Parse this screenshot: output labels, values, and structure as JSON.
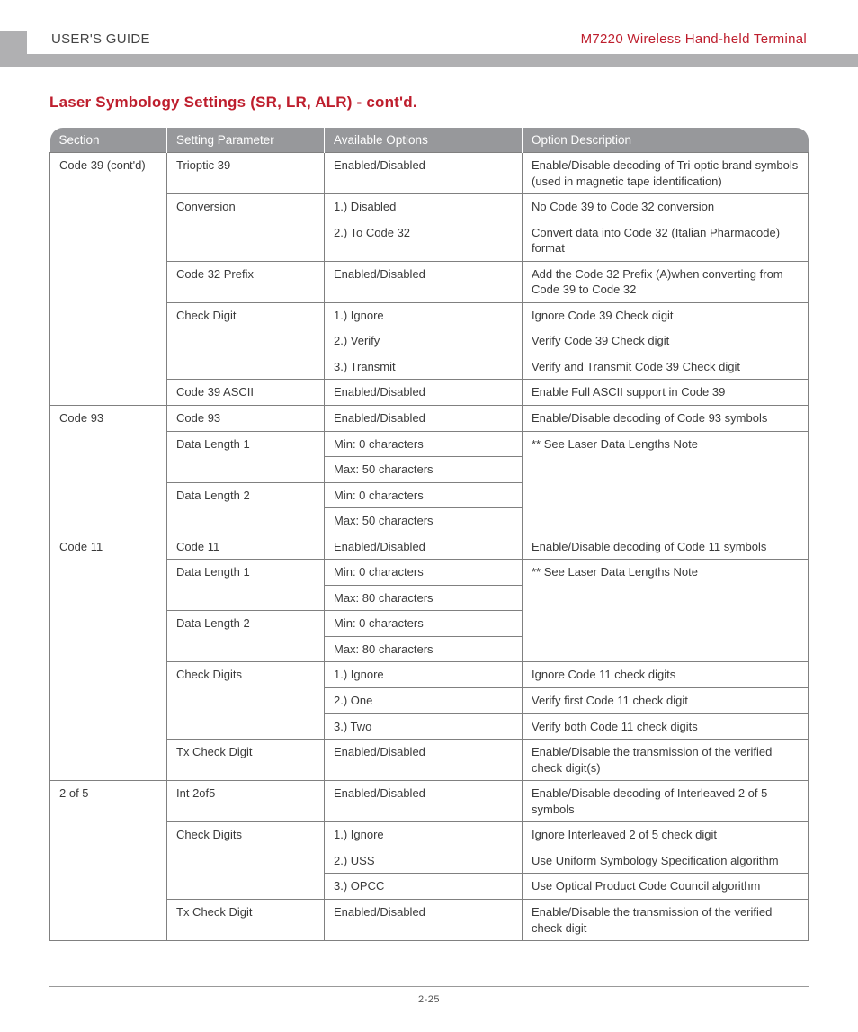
{
  "header": {
    "left": "USER'S GUIDE",
    "right": "M7220 Wireless Hand-held Terminal"
  },
  "title": "Laser Symbology Settings (SR, LR, ALR) - cont'd.",
  "columns": [
    "Section",
    "Setting Parameter",
    "Available Options",
    "Option Description"
  ],
  "rows": [
    {
      "section": "Code 39 (cont'd)",
      "section_rowspan": 8,
      "param": "Trioptic 39",
      "param_rowspan": 1,
      "option": "Enabled/Disabled",
      "desc": "Enable/Disable decoding of Tri-optic brand symbols (used in magnetic tape identification)",
      "desc_rowspan": 1
    },
    {
      "param": "Conversion",
      "param_rowspan": 2,
      "option": "1.) Disabled",
      "desc": "No Code 39 to Code 32 conversion",
      "desc_rowspan": 1
    },
    {
      "option": "2.) To Code 32",
      "desc": "Convert data into Code 32 (Italian Pharmacode) format",
      "desc_rowspan": 1
    },
    {
      "param": "Code 32 Prefix",
      "param_rowspan": 1,
      "option": "Enabled/Disabled",
      "desc": "Add the Code 32 Prefix (A)when converting from Code 39 to Code 32",
      "desc_rowspan": 1
    },
    {
      "param": "Check Digit",
      "param_rowspan": 3,
      "option": "1.) Ignore",
      "desc": "Ignore Code 39 Check digit",
      "desc_rowspan": 1
    },
    {
      "option": "2.) Verify",
      "desc": "Verify Code 39 Check digit",
      "desc_rowspan": 1
    },
    {
      "option": "3.) Transmit",
      "desc": "Verify and Transmit Code 39 Check digit",
      "desc_rowspan": 1
    },
    {
      "param": "Code 39 ASCII",
      "param_rowspan": 1,
      "option": "Enabled/Disabled",
      "desc": "Enable Full ASCII support in Code 39",
      "desc_rowspan": 1
    },
    {
      "section": "Code 93",
      "section_rowspan": 5,
      "param": "Code 93",
      "param_rowspan": 1,
      "option": "Enabled/Disabled",
      "desc": "Enable/Disable decoding of Code 93 symbols",
      "desc_rowspan": 1
    },
    {
      "param": "Data Length 1",
      "param_rowspan": 2,
      "option": "Min: 0 characters",
      "desc": "** See Laser Data Lengths Note",
      "desc_rowspan": 4
    },
    {
      "option": "Max: 50 characters"
    },
    {
      "param": "Data Length 2",
      "param_rowspan": 2,
      "option": "Min: 0 characters"
    },
    {
      "option": "Max: 50 characters"
    },
    {
      "section": "Code 11",
      "section_rowspan": 9,
      "param": "Code 11",
      "param_rowspan": 1,
      "option": "Enabled/Disabled",
      "desc": "Enable/Disable decoding of Code 11 symbols",
      "desc_rowspan": 1
    },
    {
      "param": "Data Length 1",
      "param_rowspan": 2,
      "option": "Min: 0 characters",
      "desc": "** See Laser Data Lengths Note",
      "desc_rowspan": 4
    },
    {
      "option": "Max: 80 characters"
    },
    {
      "param": "Data Length 2",
      "param_rowspan": 2,
      "option": "Min: 0 characters"
    },
    {
      "option": "Max: 80 characters"
    },
    {
      "param": "Check Digits",
      "param_rowspan": 3,
      "option": "1.) Ignore",
      "desc": "Ignore Code 11 check digits",
      "desc_rowspan": 1
    },
    {
      "option": "2.) One",
      "desc": "Verify first Code 11 check digit",
      "desc_rowspan": 1
    },
    {
      "option": "3.) Two",
      "desc": "Verify both Code 11 check digits",
      "desc_rowspan": 1
    },
    {
      "param": "Tx Check Digit",
      "param_rowspan": 1,
      "option": "Enabled/Disabled",
      "desc": "Enable/Disable the transmission of the verified check digit(s)",
      "desc_rowspan": 1
    },
    {
      "section": "2 of 5",
      "section_rowspan": 5,
      "param": "Int 2of5",
      "param_rowspan": 1,
      "option": "Enabled/Disabled",
      "desc": "Enable/Disable decoding of Interleaved 2 of 5 symbols",
      "desc_rowspan": 1
    },
    {
      "param": "Check Digits",
      "param_rowspan": 3,
      "option": "1.) Ignore",
      "desc": "Ignore Interleaved 2 of 5 check digit",
      "desc_rowspan": 1
    },
    {
      "option": "2.) USS",
      "desc": "Use Uniform Symbology Specification algorithm",
      "desc_rowspan": 1
    },
    {
      "option": "3.) OPCC",
      "desc": "Use Optical Product Code Council algorithm",
      "desc_rowspan": 1
    },
    {
      "param": "Tx Check Digit",
      "param_rowspan": 1,
      "option": "Enabled/Disabled",
      "desc": "Enable/Disable the transmission of the verified check digit",
      "desc_rowspan": 1,
      "last": true
    }
  ],
  "footer": "2-25"
}
